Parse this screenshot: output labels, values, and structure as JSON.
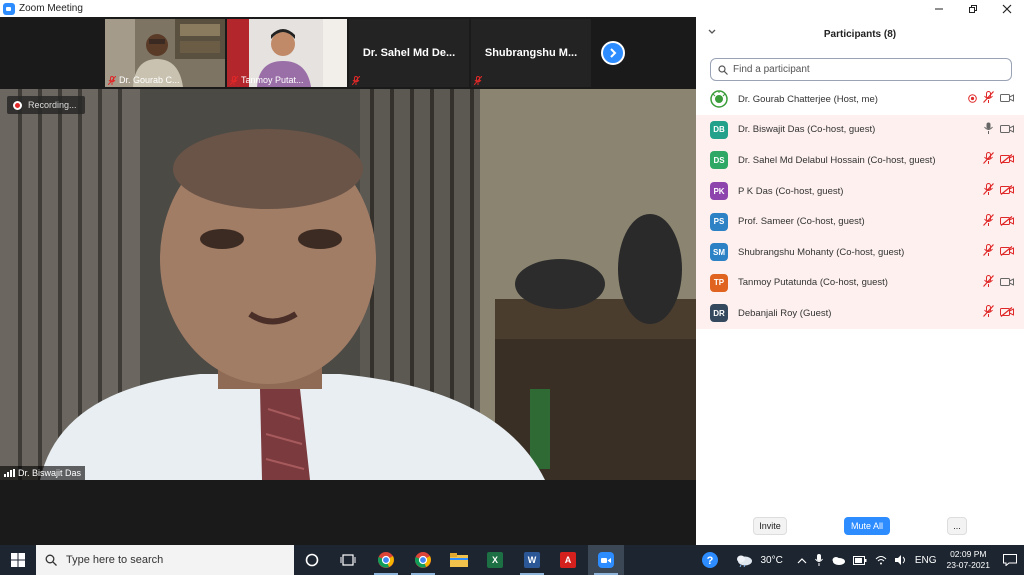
{
  "window": {
    "title": "Zoom Meeting"
  },
  "thumbnails": [
    {
      "name": "Dr. Gourab C..."
    },
    {
      "name": "Tanmoy Putat..."
    },
    {
      "name": "Dr. Sahel Md De..."
    },
    {
      "name": "Shubrangshu M..."
    }
  ],
  "main_video": {
    "recording_label": "Recording...",
    "speaker_name": "Dr. Biswajit Das"
  },
  "participants": {
    "title": "Participants (8)",
    "search_placeholder": "Find a participant",
    "list": [
      {
        "initials": "",
        "name": "Dr. Gourab Chatterjee (Host, me)",
        "avatar_color": "#ffffff",
        "highlight": false
      },
      {
        "initials": "DB",
        "name": "Dr. Biswajit Das (Co-host, guest)",
        "avatar_color": "#23a18a",
        "highlight": true
      },
      {
        "initials": "DS",
        "name": "Dr. Sahel Md Delabul Hossain (Co-host, guest)",
        "avatar_color": "#2fa866",
        "highlight": true
      },
      {
        "initials": "PK",
        "name": "P K Das (Co-host, guest)",
        "avatar_color": "#8e44ad",
        "highlight": true
      },
      {
        "initials": "PS",
        "name": "Prof. Sameer (Co-host, guest)",
        "avatar_color": "#2d82c6",
        "highlight": true
      },
      {
        "initials": "SM",
        "name": "Shubrangshu Mohanty (Co-host, guest)",
        "avatar_color": "#2d82c6",
        "highlight": true
      },
      {
        "initials": "TP",
        "name": "Tanmoy Putatunda (Co-host, guest)",
        "avatar_color": "#e0641f",
        "highlight": true
      },
      {
        "initials": "DR",
        "name": "Debanjali Roy (Guest)",
        "avatar_color": "#34495e",
        "highlight": true
      }
    ],
    "footer": {
      "invite": "Invite",
      "mute_all": "Mute All",
      "more": "..."
    }
  },
  "taskbar": {
    "search_placeholder": "Type here to search",
    "temperature": "30°C",
    "language": "ENG",
    "time": "02:09 PM",
    "date": "23-07-2021"
  },
  "colors": {
    "accent": "#2d8cff",
    "mute_red": "#e02828",
    "row_highlight": "#fdf0ef"
  }
}
